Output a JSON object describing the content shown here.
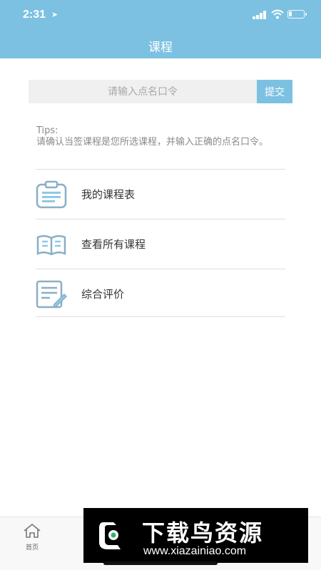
{
  "status_bar": {
    "time": "2:31",
    "location_icon": "location-arrow-icon",
    "signal_icon": "signal-icon",
    "wifi_icon": "wifi-icon",
    "battery_icon": "battery-icon",
    "battery_level": 0.15
  },
  "header": {
    "title": "课程"
  },
  "code_form": {
    "placeholder": "请输入点名口令",
    "value": "",
    "submit_label": "提交"
  },
  "tips": {
    "heading": "Tips:",
    "text": "请确认当签课程是您所选课程，并输入正确的点名口令。"
  },
  "menu": [
    {
      "label": "我的课程表",
      "icon": "clipboard-icon"
    },
    {
      "label": "查看所有课程",
      "icon": "open-book-icon"
    },
    {
      "label": "综合评价",
      "icon": "document-edit-icon"
    }
  ],
  "tabbar": {
    "home_label": "首页",
    "home_icon": "home-icon"
  },
  "watermark": {
    "name": "下载鸟资源",
    "url": "www.xiazainiao.com"
  },
  "colors": {
    "accent": "#7cc1e1",
    "icon": "#8aaec8",
    "divider": "#dedede"
  }
}
